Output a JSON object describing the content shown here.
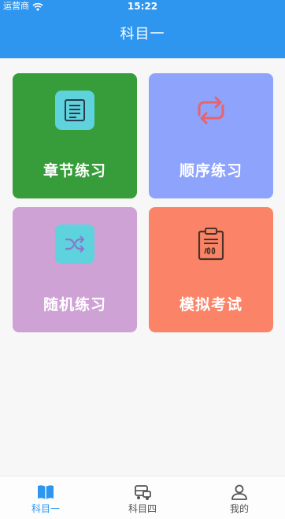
{
  "status_bar": {
    "carrier": "运营商",
    "time": "15:22"
  },
  "header": {
    "title": "科目一"
  },
  "cards": [
    {
      "label": "章节练习",
      "color": "#379d3a",
      "icon": "document-list-icon"
    },
    {
      "label": "顺序练习",
      "color": "#8ea3fb",
      "icon": "loop-icon"
    },
    {
      "label": "随机练习",
      "color": "#cfa2d6",
      "icon": "shuffle-icon"
    },
    {
      "label": "模拟考试",
      "color": "#fb8468",
      "icon": "exam-clipboard-icon"
    }
  ],
  "tabbar": {
    "items": [
      {
        "label": "科目一",
        "icon": "book-icon",
        "active": true
      },
      {
        "label": "科目四",
        "icon": "car-icon",
        "active": false
      },
      {
        "label": "我的",
        "icon": "person-icon",
        "active": false
      }
    ],
    "active_color": "#2f96ef"
  },
  "colors": {
    "header": "#2f96ef",
    "background": "#f7f7f7"
  }
}
